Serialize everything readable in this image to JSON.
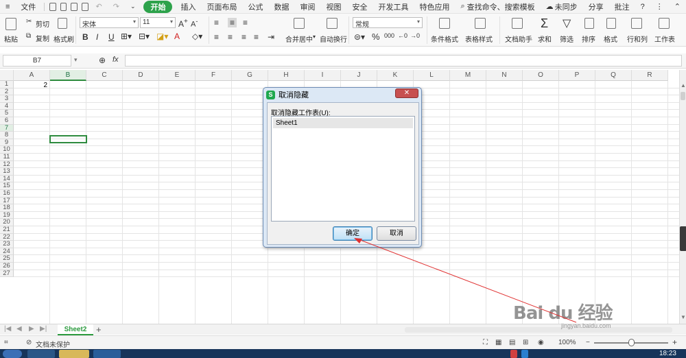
{
  "menubar": {
    "file": "文件",
    "items": [
      "开始",
      "插入",
      "页面布局",
      "公式",
      "数据",
      "审阅",
      "视图",
      "安全",
      "开发工具",
      "特色应用"
    ],
    "active": "开始",
    "search": "查找命令、搜索模板",
    "sync": "未同步",
    "share": "分享",
    "comment": "批注",
    "help": "?"
  },
  "ribbon": {
    "paste": "粘贴",
    "cut": "剪切",
    "copy": "复制",
    "format_painter": "格式刷",
    "font_name": "宋体",
    "font_size": "11",
    "bold": "B",
    "italic": "I",
    "underline": "U",
    "font_color": "A",
    "merge_center": "合并居中",
    "wrap": "自动换行",
    "number_format": "常规",
    "percent": "%",
    "thousands": "000",
    "cond_format": "条件格式",
    "table_style": "表格样式",
    "doc_assistant": "文档助手",
    "sum": "求和",
    "filter": "筛选",
    "sort": "排序",
    "format": "格式",
    "row_col": "行和列",
    "worksheet": "工作表"
  },
  "formula_bar": {
    "name_box": "B7",
    "fx": "fx",
    "content": ""
  },
  "grid": {
    "columns": [
      "A",
      "B",
      "C",
      "D",
      "E",
      "F",
      "G",
      "H",
      "I",
      "J",
      "K",
      "L",
      "M",
      "N",
      "O",
      "P",
      "Q",
      "R"
    ],
    "rows": [
      "1",
      "2",
      "3",
      "4",
      "5",
      "6",
      "7",
      "8",
      "9",
      "10",
      "11",
      "12",
      "13",
      "14",
      "15",
      "16",
      "17",
      "18",
      "19",
      "20",
      "21",
      "22",
      "23",
      "24",
      "25",
      "26",
      "27"
    ],
    "selected_column": "B",
    "selected_row": "7",
    "cells": {
      "A1": "2"
    }
  },
  "sheets": {
    "active_tab": "Sheet2",
    "add": "+"
  },
  "statusbar": {
    "protect": "文档未保护",
    "zoom": "100%",
    "zoom_level": 1.0
  },
  "taskbar": {
    "clock": "18:23"
  },
  "dialog": {
    "title": "取消隐藏",
    "logo": "S",
    "close": "✕",
    "label": "取消隐藏工作表(U):",
    "items": [
      "Sheet1"
    ],
    "ok": "确定",
    "cancel": "取消"
  },
  "watermark": {
    "brand": "Bai du 经验",
    "url": "jingyan.baidu.com"
  },
  "colors": {
    "accent": "#2da24b",
    "selection": "#2e8b3e",
    "dialog_bg": "#dce8f5",
    "annotation": "#e03030"
  }
}
